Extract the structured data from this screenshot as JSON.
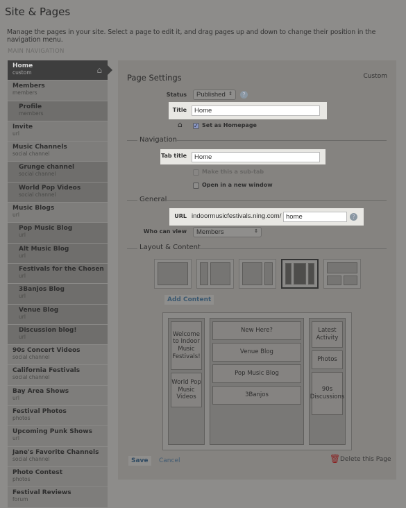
{
  "header": {
    "title": "Site & Pages",
    "description": "Manage the pages in your site. Select a page to edit it, and drag pages up and down to change their position in the navigation menu.",
    "section": "MAIN NAVIGATION"
  },
  "sidebar": {
    "items": [
      {
        "name": "Home",
        "type": "custom",
        "sub": false,
        "selected": true
      },
      {
        "name": "Members",
        "type": "members",
        "sub": false
      },
      {
        "name": "Profile",
        "type": "members",
        "sub": true
      },
      {
        "name": "Invite",
        "type": "url",
        "sub": false
      },
      {
        "name": "Music Channels",
        "type": "social channel",
        "sub": false
      },
      {
        "name": "Grunge channel",
        "type": "social channel",
        "sub": true
      },
      {
        "name": "World Pop Videos",
        "type": "social channel",
        "sub": true
      },
      {
        "name": "Music Blogs",
        "type": "url",
        "sub": false
      },
      {
        "name": "Pop Music Blog",
        "type": "url",
        "sub": true
      },
      {
        "name": "Alt Music Blog",
        "type": "url",
        "sub": true
      },
      {
        "name": "Festivals for the Chosen",
        "type": "url",
        "sub": true
      },
      {
        "name": "3Banjos Blog",
        "type": "url",
        "sub": true
      },
      {
        "name": "Venue Blog",
        "type": "url",
        "sub": true
      },
      {
        "name": "Discussion blog!",
        "type": "url",
        "sub": true
      },
      {
        "name": "90s Concert Videos",
        "type": "social channel",
        "sub": false
      },
      {
        "name": "California Festivals",
        "type": "social channel",
        "sub": false
      },
      {
        "name": "Bay Area Shows",
        "type": "url",
        "sub": false
      },
      {
        "name": "Festival Photos",
        "type": "photos",
        "sub": false
      },
      {
        "name": "Upcoming Punk Shows",
        "type": "url",
        "sub": false
      },
      {
        "name": "Jane's Favorite Channels",
        "type": "social channel",
        "sub": false
      },
      {
        "name": "Photo Contest",
        "type": "photos",
        "sub": false
      },
      {
        "name": "Festival Reviews",
        "type": "forum",
        "sub": false
      }
    ]
  },
  "settings": {
    "heading": "Page Settings",
    "page_type": "Custom",
    "status_label": "Status",
    "status_value": "Published",
    "title_label": "Title",
    "title_value": "Home",
    "homepage_label": "Set as Homepage",
    "homepage_checked": true,
    "navigation_heading": "Navigation",
    "tab_title_label": "Tab title",
    "tab_title_value": "Home",
    "subtab_label": "Make this a sub-tab",
    "new_window_label": "Open in a new window",
    "general_heading": "General",
    "url_label": "URL",
    "url_prefix": "indoormusicfestivals.ning.com/",
    "url_value": "home",
    "who_label": "Who can view",
    "who_value": "Members",
    "layout_heading": "Layout & Content",
    "add_content": "Add Content",
    "selected_layout": 4,
    "columns": {
      "left": [
        "Welcome to Indoor Music Festivals!",
        "World Pop Music Videos"
      ],
      "center": [
        "New Here?",
        "Venue Blog",
        "Pop Music Blog",
        "3Banjos"
      ],
      "right": [
        "Latest Activity",
        "Photos",
        "90s Discussions"
      ]
    },
    "save": "Save",
    "cancel": "Cancel",
    "delete": "Delete this Page"
  }
}
